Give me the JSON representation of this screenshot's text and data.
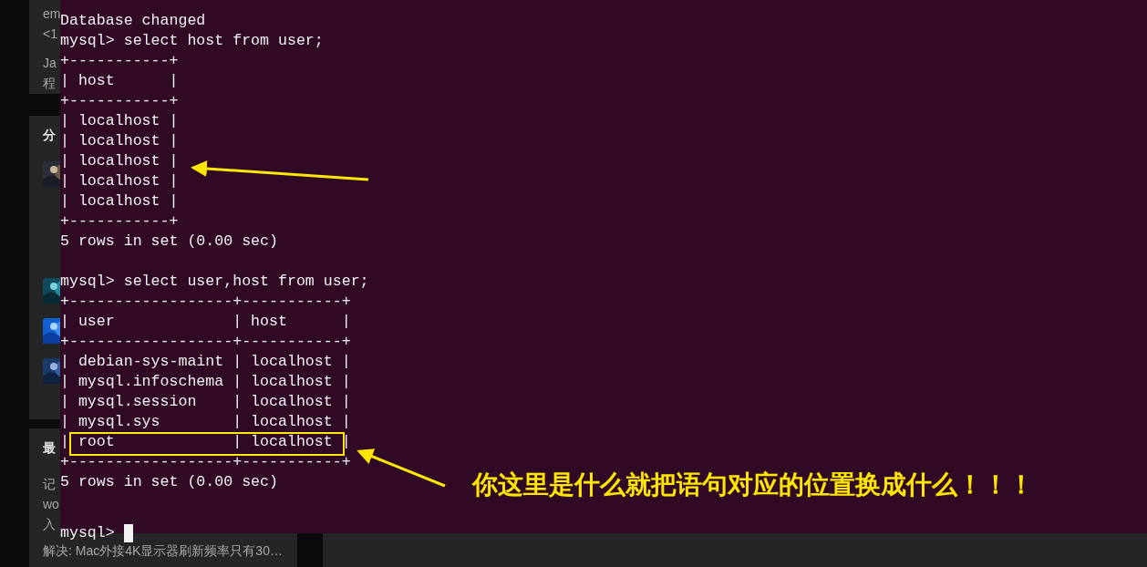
{
  "sidebar": {
    "cards": [
      {
        "items": [
          {
            "kind": "text",
            "text": "em"
          },
          {
            "kind": "text",
            "text": "<1"
          },
          {
            "kind": "text",
            "text": "Ja"
          },
          {
            "kind": "text",
            "text": "程"
          }
        ]
      },
      {
        "items": [
          {
            "kind": "heading",
            "text": "分"
          },
          {
            "kind": "picture"
          },
          {
            "kind": "gap"
          },
          {
            "kind": "picture"
          },
          {
            "kind": "picture"
          },
          {
            "kind": "picture"
          }
        ]
      },
      {
        "items": [
          {
            "kind": "heading",
            "text": "最"
          },
          {
            "kind": "text",
            "text": "记"
          },
          {
            "kind": "text",
            "text": "wo"
          },
          {
            "kind": "text",
            "text": "入"
          },
          {
            "kind": "text",
            "text": "解决: Mac外接4K显示器刷新频率只有30…"
          }
        ]
      }
    ]
  },
  "terminal": {
    "lines": [
      {
        "kind": "output",
        "text": "Database changed",
        "highlighted": false
      },
      {
        "kind": "output",
        "text": "mysql> select host from user;",
        "highlighted": false
      },
      {
        "kind": "output",
        "text": "+-----------+",
        "highlighted": false
      },
      {
        "kind": "output",
        "text": "| host      |",
        "highlighted": false
      },
      {
        "kind": "output",
        "text": "+-----------+",
        "highlighted": false
      },
      {
        "kind": "output",
        "text": "| localhost |",
        "highlighted": false
      },
      {
        "kind": "output",
        "text": "| localhost |",
        "highlighted": false
      },
      {
        "kind": "output",
        "text": "| localhost |",
        "highlighted": false
      },
      {
        "kind": "output",
        "text": "| localhost |",
        "highlighted": false
      },
      {
        "kind": "output",
        "text": "| localhost |",
        "highlighted": false
      },
      {
        "kind": "output",
        "text": "+-----------+",
        "highlighted": false
      },
      {
        "kind": "output",
        "text": "5 rows in set (0.00 sec)",
        "highlighted": false
      },
      {
        "kind": "blank"
      },
      {
        "kind": "output",
        "text": "mysql> select user,host from user;",
        "highlighted": false
      },
      {
        "kind": "output",
        "text": "+------------------+-----------+",
        "highlighted": false
      },
      {
        "kind": "output",
        "text": "| user             | host      |",
        "highlighted": false
      },
      {
        "kind": "output",
        "text": "+------------------+-----------+",
        "highlighted": false
      },
      {
        "kind": "output",
        "text": "| debian-sys-maint | localhost |",
        "highlighted": false
      },
      {
        "kind": "output",
        "text": "| mysql.infoschema | localhost |",
        "highlighted": false
      },
      {
        "kind": "output",
        "text": "| mysql.session    | localhost |",
        "highlighted": false
      },
      {
        "kind": "output",
        "text": "| mysql.sys        | localhost |",
        "highlighted": false
      },
      {
        "kind": "output",
        "text": "| root             | localhost |",
        "highlighted": true
      },
      {
        "kind": "output",
        "text": "+------------------+-----------+",
        "highlighted": false
      },
      {
        "kind": "output",
        "text": "5 rows in set (0.00 sec)",
        "highlighted": false
      },
      {
        "kind": "blank"
      },
      {
        "kind": "prompt",
        "text": "mysql>"
      }
    ]
  },
  "annotation": {
    "text": "你这里是什么就把语句对应的位置换成什么！！！"
  }
}
